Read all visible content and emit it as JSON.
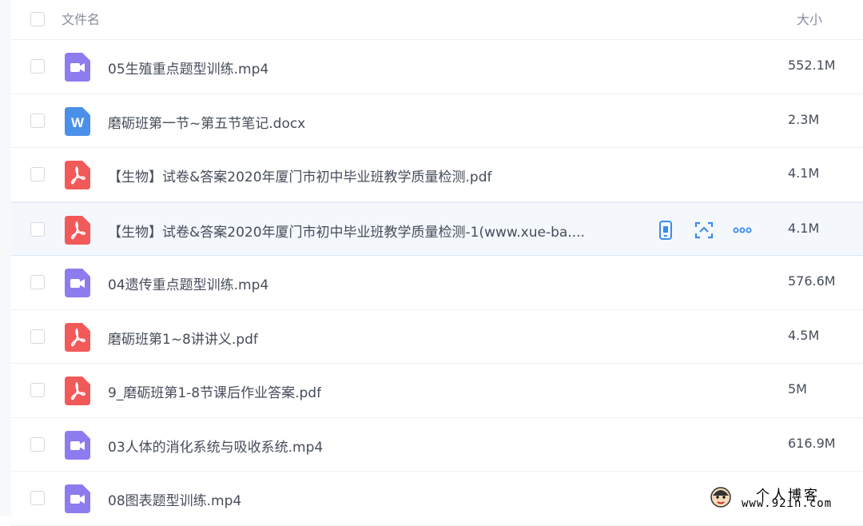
{
  "header": {
    "name_label": "文件名",
    "size_label": "大小"
  },
  "files": [
    {
      "name": "05生殖重点题型训练.mp4",
      "size": "552.1M",
      "type": "video"
    },
    {
      "name": "磨砺班第一节~第五节笔记.docx",
      "size": "2.3M",
      "type": "word"
    },
    {
      "name": "【生物】试卷&答案2020年厦门市初中毕业班教学质量检测.pdf",
      "size": "4.1M",
      "type": "pdf"
    },
    {
      "name": "【生物】试卷&答案2020年厦门市初中毕业班教学质量检测-1(www.xue-ba....",
      "size": "4.1M",
      "type": "pdf",
      "hovered": true
    },
    {
      "name": "04遗传重点题型训练.mp4",
      "size": "576.6M",
      "type": "video"
    },
    {
      "name": "磨砺班第1~8讲讲义.pdf",
      "size": "4.5M",
      "type": "pdf"
    },
    {
      "name": "9_磨砺班第1-8节课后作业答案.pdf",
      "size": "5M",
      "type": "pdf"
    },
    {
      "name": "03人体的消化系统与吸收系统.mp4",
      "size": "616.9M",
      "type": "video"
    },
    {
      "name": "08图表题型训练.mp4",
      "size": "",
      "type": "video"
    }
  ],
  "icons": {
    "video": "video-file-icon",
    "word": "word-file-icon",
    "pdf": "pdf-file-icon",
    "word_letter": "W"
  },
  "row_actions": [
    "phone-icon",
    "share-icon",
    "more-icon"
  ],
  "colors": {
    "video": "#8c7cf0",
    "word": "#4a90e8",
    "pdf": "#f25a5a",
    "accent": "#3b8cf0",
    "hover_bg": "#f4f8fd"
  },
  "watermark": {
    "title": "个人博客",
    "url": "www.92in.com"
  }
}
